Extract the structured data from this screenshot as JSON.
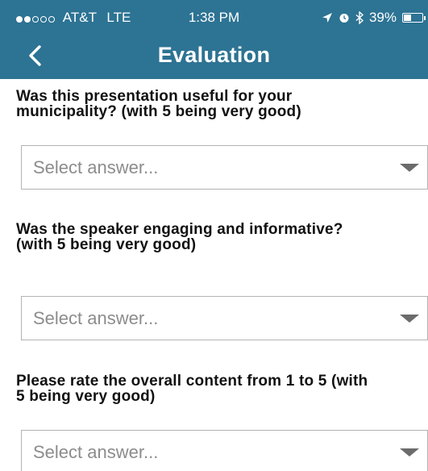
{
  "status_bar": {
    "carrier": "AT&T",
    "network": "LTE",
    "time": "1:38 PM",
    "battery_text": "39%",
    "battery_level": 0.39,
    "signal_strength": 2,
    "signal_max": 5,
    "icons": [
      "location-arrow-icon",
      "alarm-icon",
      "bluetooth-icon",
      "battery-icon"
    ]
  },
  "nav": {
    "title": "Evaluation",
    "back_icon": "chevron-left-icon"
  },
  "questions": [
    {
      "line1": "Was this presentation useful for your",
      "line2": "municipality? (with 5 being very good)",
      "select_placeholder": "Select answer..."
    },
    {
      "line1": "Was the speaker engaging and informative?",
      "line2": "(with 5 being very good)",
      "select_placeholder": "Select answer..."
    },
    {
      "line1": "Please rate the overall content from 1 to 5 (with",
      "line2": "5 being very good)",
      "select_placeholder": "Select answer..."
    }
  ],
  "colors": {
    "header": "#2d7393",
    "placeholder": "#8c8c8c",
    "border": "#b3b3b3"
  }
}
